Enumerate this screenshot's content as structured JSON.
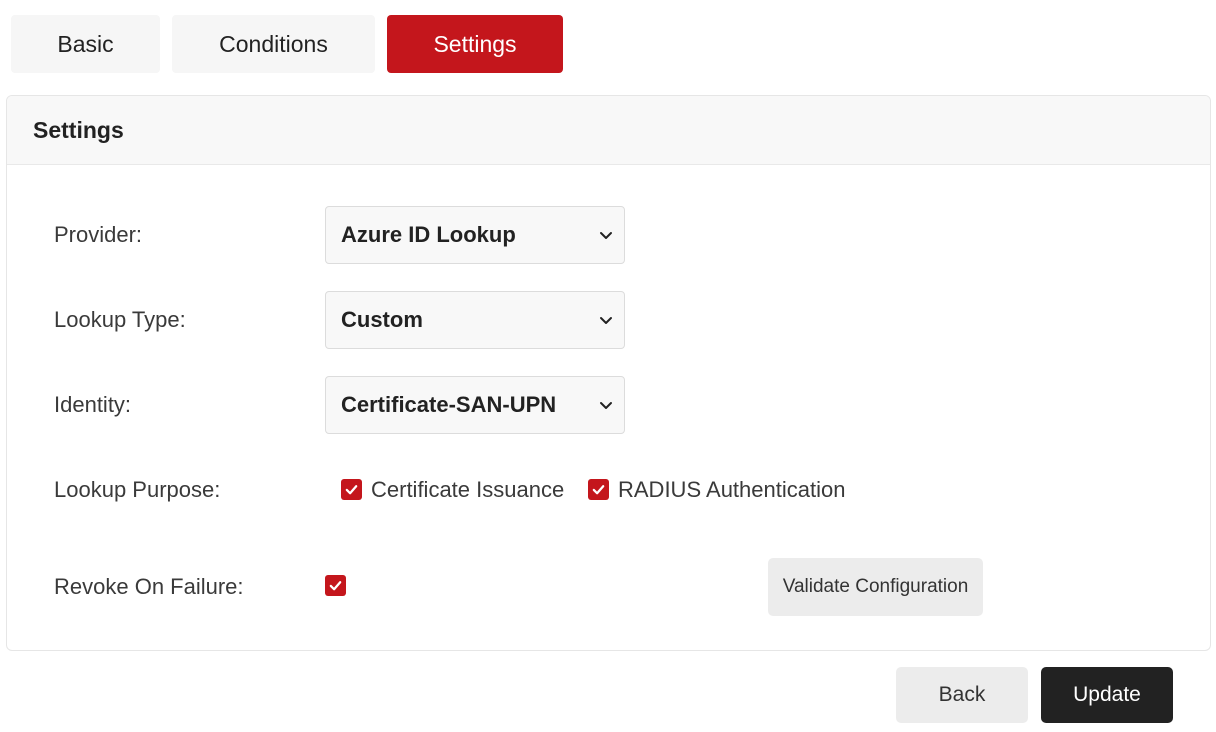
{
  "tabs": [
    {
      "label": "Basic",
      "active": false
    },
    {
      "label": "Conditions",
      "active": false
    },
    {
      "label": "Settings",
      "active": true
    }
  ],
  "card": {
    "title": "Settings"
  },
  "form": {
    "provider": {
      "label": "Provider:",
      "value": "Azure ID Lookup"
    },
    "lookup_type": {
      "label": "Lookup Type:",
      "value": "Custom"
    },
    "identity": {
      "label": "Identity:",
      "value": "Certificate-SAN-UPN"
    },
    "lookup_purpose": {
      "label": "Lookup Purpose:",
      "options": [
        {
          "label": "Certificate Issuance",
          "checked": true
        },
        {
          "label": "RADIUS Authentication",
          "checked": true
        }
      ]
    },
    "revoke_on_failure": {
      "label": "Revoke On Failure:",
      "checked": true
    },
    "validate_label": "Validate Configuration"
  },
  "footer": {
    "back_label": "Back",
    "update_label": "Update"
  },
  "colors": {
    "accent": "#c4161c",
    "primary_button": "#222222",
    "secondary_button": "#ececec"
  }
}
